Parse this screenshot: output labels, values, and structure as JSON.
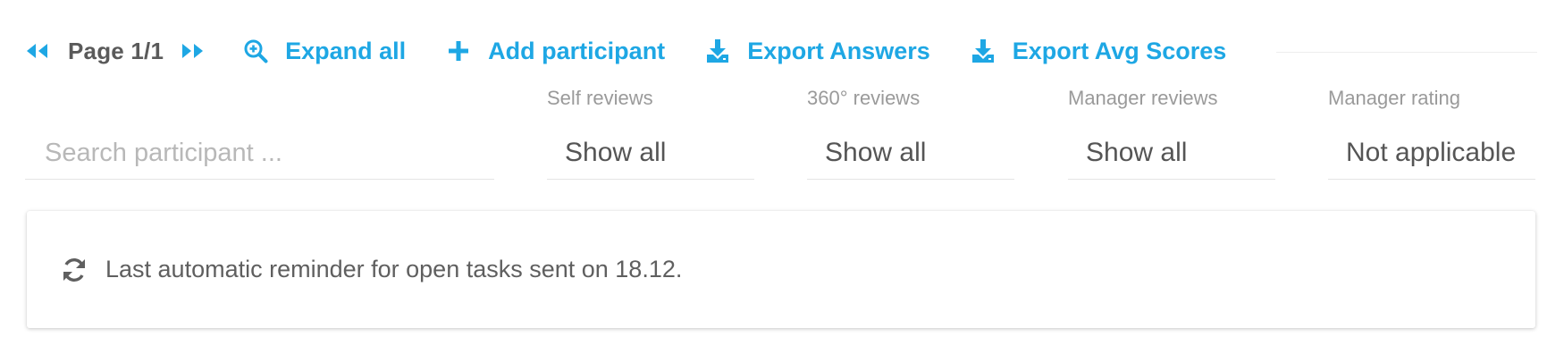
{
  "colors": {
    "accent": "#1ea7e4",
    "text": "#555555",
    "muted": "#9a9a9a",
    "placeholder": "#b8b8b8"
  },
  "pager": {
    "label": "Page 1/1",
    "prev_icon": "double-chevron-left-icon",
    "next_icon": "double-chevron-right-icon"
  },
  "actions": {
    "expand": {
      "label": "Expand all",
      "icon": "zoom-in-icon"
    },
    "add": {
      "label": "Add participant",
      "icon": "plus-icon"
    },
    "export_answers": {
      "label": "Export Answers",
      "icon": "download-icon"
    },
    "export_avg": {
      "label": "Export Avg Scores",
      "icon": "download-icon"
    }
  },
  "search": {
    "placeholder": "Search participant ...",
    "value": ""
  },
  "filters": {
    "self_reviews": {
      "label": "Self reviews",
      "value": "Show all"
    },
    "reviews_360": {
      "label": "360° reviews",
      "value": "Show all"
    },
    "manager_reviews": {
      "label": "Manager reviews",
      "value": "Show all"
    },
    "manager_rating": {
      "label": "Manager rating",
      "value": "Not applicable"
    }
  },
  "reminder": {
    "icon": "refresh-icon",
    "text": "Last automatic reminder for open tasks sent on 18.12."
  }
}
